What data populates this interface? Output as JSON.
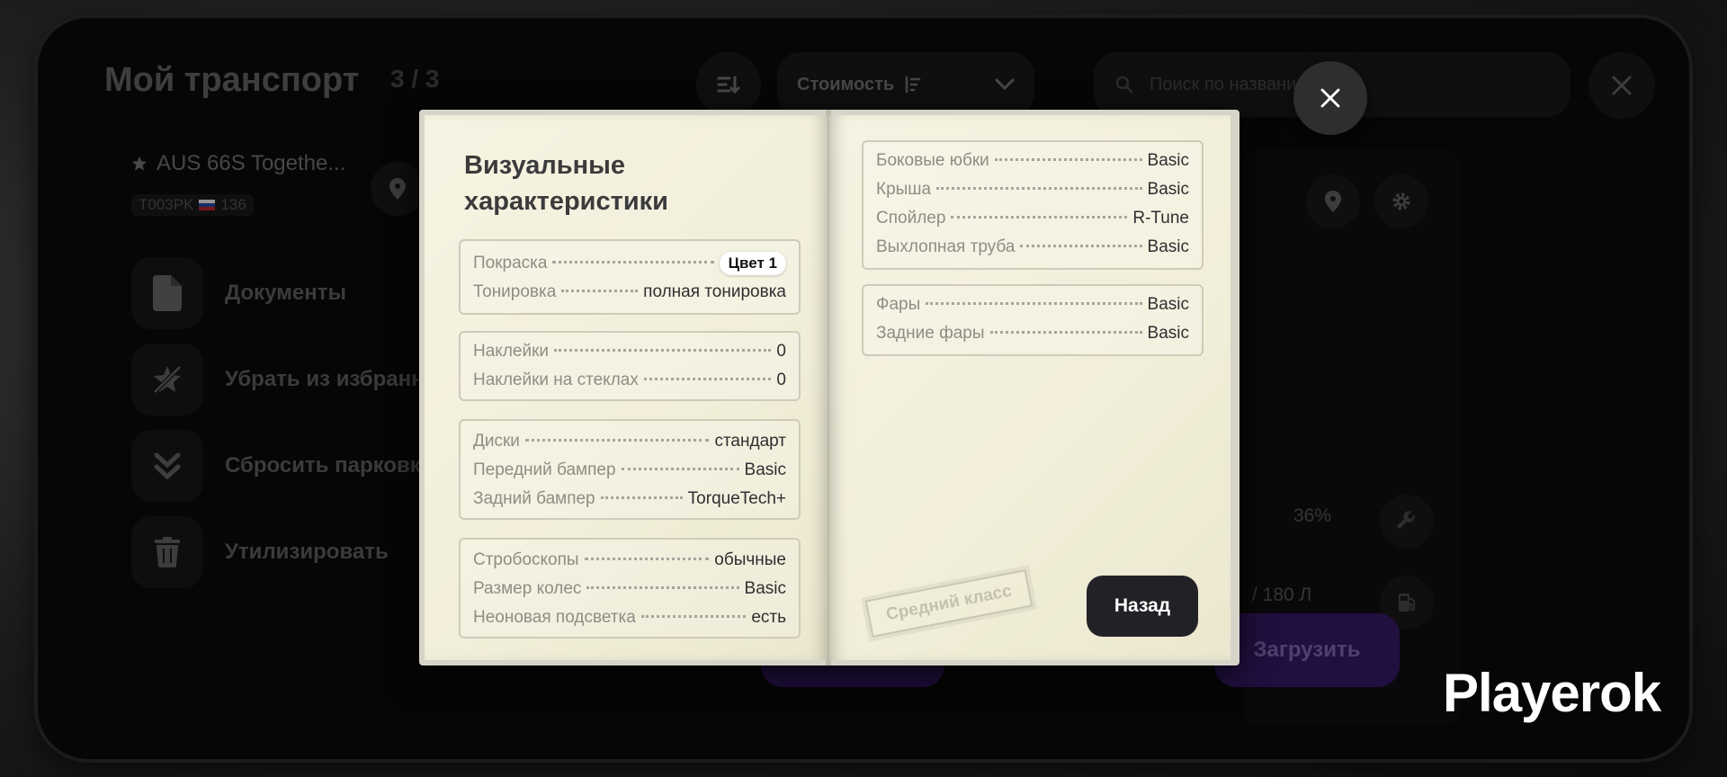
{
  "header": {
    "title": "Мой транспорт",
    "count": "3 / 3",
    "sort_select_value": "Стоимость",
    "search_placeholder": "Поиск по названию"
  },
  "vehicle": {
    "name": "AUS 66S Togethe...",
    "plate": "T003PK",
    "region": "136"
  },
  "menu": [
    {
      "label": "Документы"
    },
    {
      "label": "Убрать из избранного"
    },
    {
      "label": "Сбросить парковку"
    },
    {
      "label": "Утилизировать"
    }
  ],
  "card": {
    "condition": "36%",
    "fuel": "/ 180 Л",
    "load_button": "Загрузить"
  },
  "book": {
    "title": "Визуальные\n характеристики",
    "left_groups": [
      [
        {
          "label": "Покраска",
          "value": "Цвет 1"
        },
        {
          "label": "Тонировка",
          "value": "полная тонировка"
        }
      ],
      [
        {
          "label": "Наклейки",
          "value": "0"
        },
        {
          "label": "Наклейки на стеклах",
          "value": "0"
        }
      ],
      [
        {
          "label": "Диски",
          "value": "стандарт"
        },
        {
          "label": "Передний бампер",
          "value": "Basic"
        },
        {
          "label": "Задний бампер",
          "value": "TorqueTech+"
        }
      ],
      [
        {
          "label": "Стробоскопы",
          "value": "обычные"
        },
        {
          "label": "Размер колес",
          "value": "Basic"
        },
        {
          "label": "Неоновая подсветка",
          "value": "есть"
        }
      ]
    ],
    "right_groups": [
      [
        {
          "label": "Боковые юбки",
          "value": "Basic"
        },
        {
          "label": "Крыша",
          "value": "Basic"
        },
        {
          "label": "Спойлер",
          "value": "R-Tune"
        },
        {
          "label": "Выхлопная труба",
          "value": "Basic"
        }
      ],
      [
        {
          "label": "Фары",
          "value": "Basic"
        },
        {
          "label": "Задние фары",
          "value": "Basic"
        }
      ]
    ],
    "stamp": "Средний класс",
    "back_button": "Назад"
  },
  "watermark": "Playerok",
  "colors": {
    "accent_purple": "#3a1b6e",
    "paper": "#f4f1de",
    "button_dark": "#222226"
  }
}
